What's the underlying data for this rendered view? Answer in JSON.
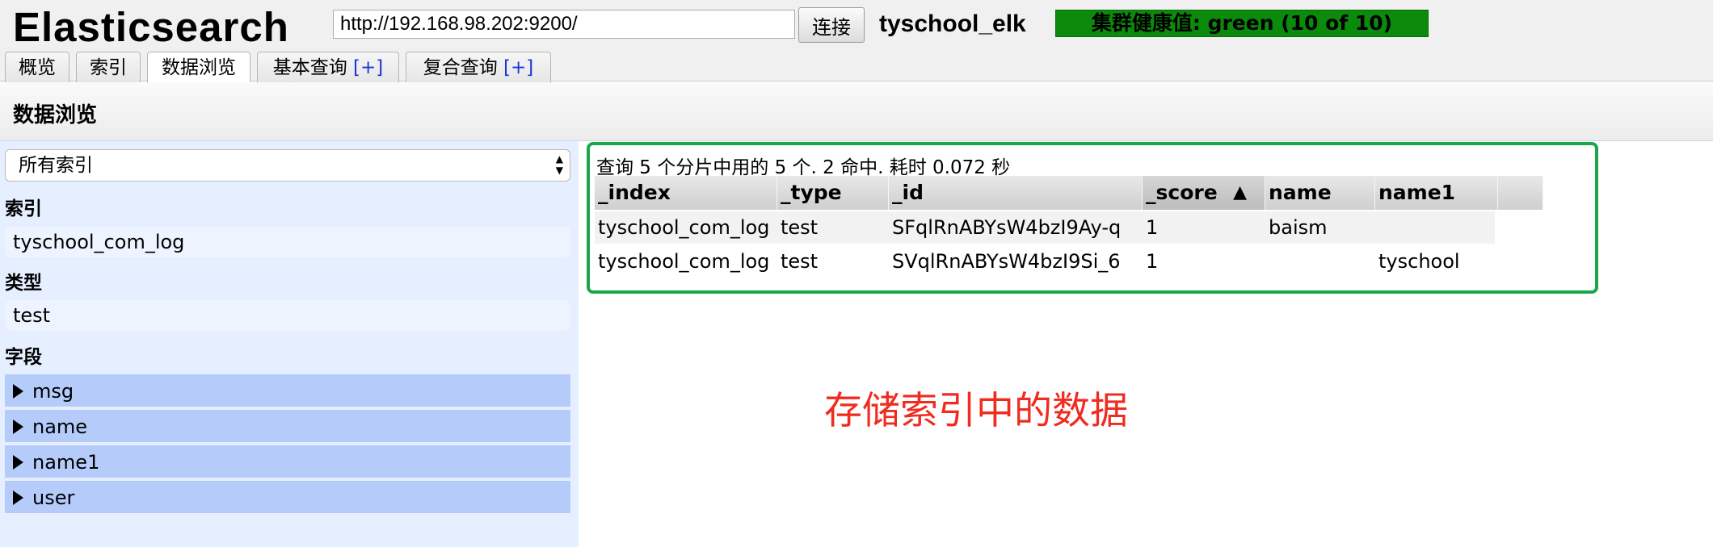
{
  "app": {
    "logo": "Elasticsearch"
  },
  "connection": {
    "url": "http://192.168.98.202:9200/",
    "connect_label": "连接",
    "cluster_name": "tyschool_elk",
    "health": "集群健康值: green (10 of 10)"
  },
  "tabs": [
    {
      "label": "概览",
      "plus": ""
    },
    {
      "label": "索引",
      "plus": ""
    },
    {
      "label": "数据浏览",
      "plus": ""
    },
    {
      "label": "基本查询 ",
      "plus": "[+]"
    },
    {
      "label": "复合查询 ",
      "plus": "[+]"
    }
  ],
  "page": {
    "title": "数据浏览"
  },
  "sidebar": {
    "index_select": "所有索引",
    "index_head": "索引",
    "index_value": "tyschool_com_log",
    "type_head": "类型",
    "type_value": "test",
    "field_head": "字段",
    "fields": [
      "msg",
      "name",
      "name1",
      "user"
    ]
  },
  "results": {
    "summary": "查询 5 个分片中用的 5 个. 2 命中. 耗时 0.072 秒",
    "columns": [
      "_index",
      "_type",
      "_id",
      "_score",
      "name",
      "name1"
    ],
    "sort_indicator": "▲",
    "rows": [
      [
        "tyschool_com_log",
        "test",
        "SFqlRnABYsW4bzI9Ay-q",
        "1",
        "baism",
        ""
      ],
      [
        "tyschool_com_log",
        "test",
        "SVqlRnABYsW4bzI9Si_6",
        "1",
        "",
        "tyschool"
      ]
    ]
  },
  "annotation": "存储索引中的数据",
  "colors": {
    "health_green": "#0b8a0b",
    "highlight_border": "#1aa64a",
    "annotation_red": "#f02b1f",
    "field_row": "#b5ccfb",
    "sidebar_bg": "#e6efff"
  }
}
